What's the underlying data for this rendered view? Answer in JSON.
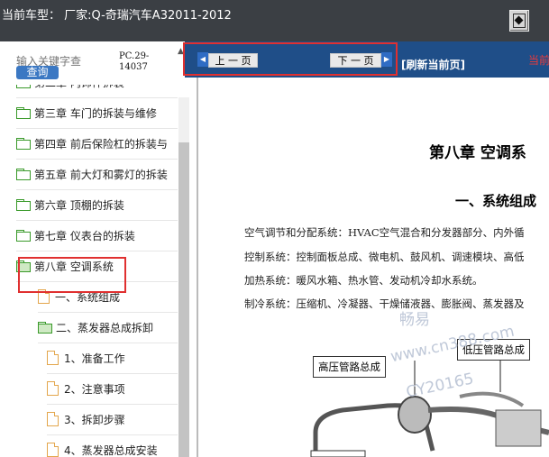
{
  "header": {
    "car_type_label": "当前车型：  厂家:Q-奇瑞汽车A32011-2012"
  },
  "search": {
    "placeholder": "输入关键字查",
    "button_label": "查询",
    "pc_code": "PC.29-14037"
  },
  "tree": {
    "items": [
      {
        "label": "第二章 内饰件拆装",
        "type": "folder"
      },
      {
        "label": "第三章 车门的拆装与维修",
        "type": "folder"
      },
      {
        "label": "第四章 前后保险杠的拆装与",
        "type": "folder"
      },
      {
        "label": "第五章 前大灯和雾灯的拆装",
        "type": "folder"
      },
      {
        "label": "第六章 顶棚的拆装",
        "type": "folder"
      },
      {
        "label": "第七章 仪表台的拆装",
        "type": "folder"
      },
      {
        "label": "第八章 空调系统",
        "type": "folder-open"
      },
      {
        "label": "一、系统组成",
        "type": "doc"
      },
      {
        "label": "二、蒸发器总成拆卸",
        "type": "folder-open"
      },
      {
        "label": "1、准备工作",
        "type": "doc"
      },
      {
        "label": "2、注意事项",
        "type": "doc"
      },
      {
        "label": "3、拆卸步骤",
        "type": "doc"
      },
      {
        "label": "4、蒸发器总成安装",
        "type": "doc"
      }
    ]
  },
  "nav": {
    "prev_label": "上 一 页",
    "next_label": "下 一 页",
    "refresh_label": "[刷新当前页]",
    "current_page_label": "当前"
  },
  "document": {
    "chapter_title": "第八章   空调系",
    "section_title": "一、系统组成",
    "paragraphs": [
      "空气调节和分配系统：HVAC空气混合和分发器部分、内外循",
      "控制系统：控制面板总成、微电机、鼓风机、调速模块、高低",
      "加热系统：暖风水箱、热水管、发动机冷却水系统。",
      "制冷系统：压缩机、冷凝器、干燥储液器、膨胀阀、蒸发器及"
    ],
    "diagram_labels": {
      "low_pressure": "低压管路总成",
      "high_pressure": "高压管路总成"
    },
    "watermarks": [
      "畅易",
      "www.cn388.com",
      "CY20165"
    ]
  },
  "colors": {
    "topbar": "#3b3f44",
    "navbar": "#1f4e88",
    "highlight": "#e03030",
    "folder_green": "#3a9a2a",
    "doc_orange": "#e3a64c"
  }
}
